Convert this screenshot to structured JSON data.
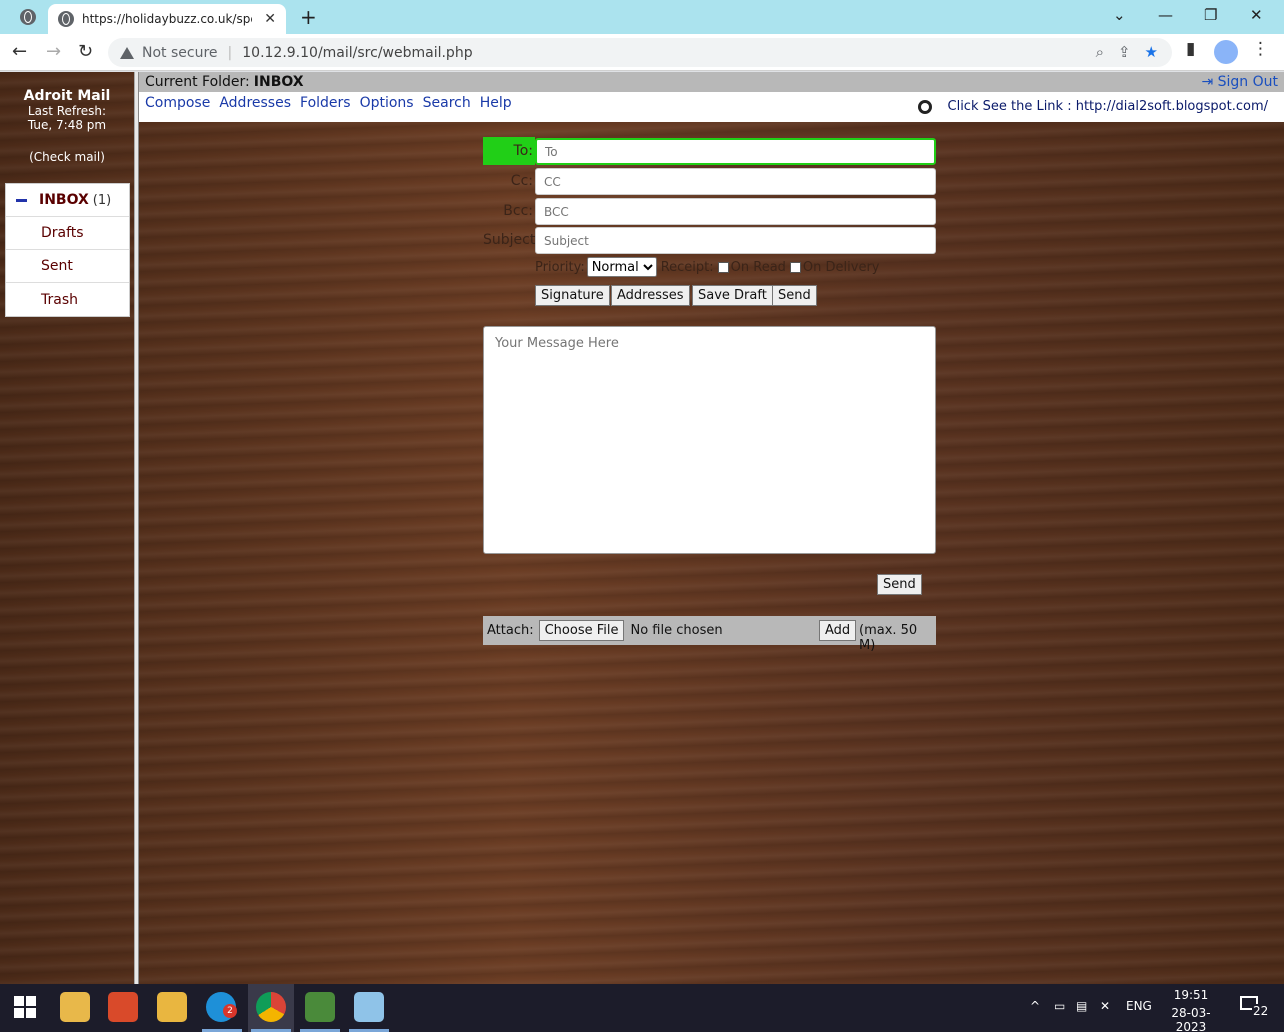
{
  "browser": {
    "tab_title": "https://holidaybuzz.co.uk/specia",
    "tab_close": "✕",
    "new_tab": "+",
    "security_label": "Not secure",
    "url": "10.12.9.10/mail/src/webmail.php"
  },
  "sidebar": {
    "brand": "Adroit Mail",
    "last_refresh_label": "Last Refresh:",
    "last_refresh_time": "Tue, 7:48 pm",
    "check_mail": "(Check mail)",
    "folders": [
      {
        "label": "INBOX",
        "count": "(1)"
      },
      {
        "label": "Drafts"
      },
      {
        "label": "Sent"
      },
      {
        "label": "Trash"
      }
    ]
  },
  "header": {
    "current_folder_label": "Current Folder:",
    "current_folder": "INBOX",
    "sign_out": "Sign Out",
    "link_note": "Click See the Link : http://dial2soft.blogspot.com/"
  },
  "menu": [
    "Compose",
    "Addresses",
    "Folders",
    "Options",
    "Search",
    "Help"
  ],
  "compose": {
    "to_label": "To:",
    "to_placeholder": "To",
    "cc_label": "Cc:",
    "cc_placeholder": "CC",
    "bcc_label": "Bcc:",
    "bcc_placeholder": "BCC",
    "subject_label": "Subject:",
    "subject_placeholder": "Subject",
    "priority_label": "Priority:",
    "priority_value": "Normal",
    "receipt_label": "Receipt:",
    "on_read": "On Read",
    "on_delivery": "On Delivery",
    "buttons": [
      "Signature",
      "Addresses",
      "Save Draft",
      "Send"
    ],
    "message_placeholder": "Your Message Here",
    "send_bottom": "Send",
    "attach_label": "Attach:",
    "choose_file": "Choose File",
    "no_file": "No file chosen",
    "add": "Add",
    "max": "(max. 50 M)"
  },
  "taskbar": {
    "lang": "ENG",
    "time": "19:51",
    "date": "28-03-2023",
    "notifications": "22",
    "skype_badge": "2"
  }
}
